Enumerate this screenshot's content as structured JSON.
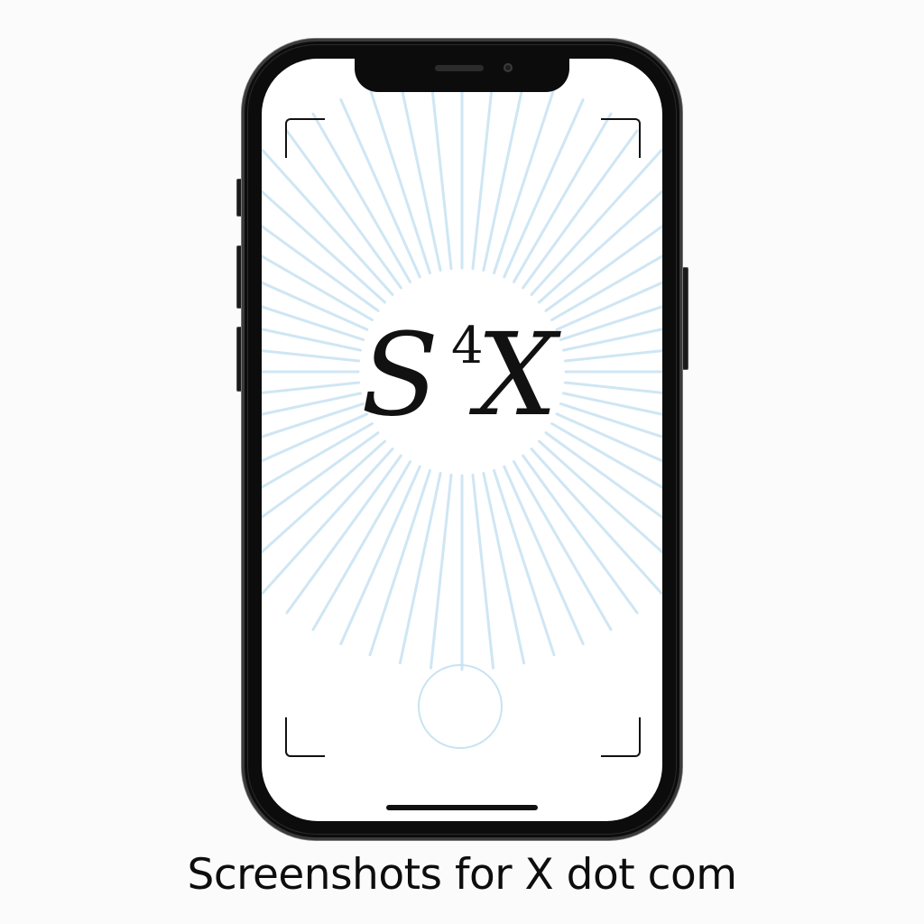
{
  "logo": {
    "letter_base": "S",
    "superscript": "4",
    "letter_second": "X"
  },
  "caption": "Screenshots for X dot com",
  "colors": {
    "phone_frame": "#0c0c0c",
    "screen": "#ffffff",
    "burst_rays": "#cfe6f4",
    "shutter_ring": "#c8e3f2",
    "text": "#111111"
  },
  "icons": {
    "shutter": "shutter-button-icon",
    "viewfinder": "viewfinder-corner-icon",
    "camera": "front-camera-icon",
    "speaker": "earpiece-speaker-icon"
  }
}
